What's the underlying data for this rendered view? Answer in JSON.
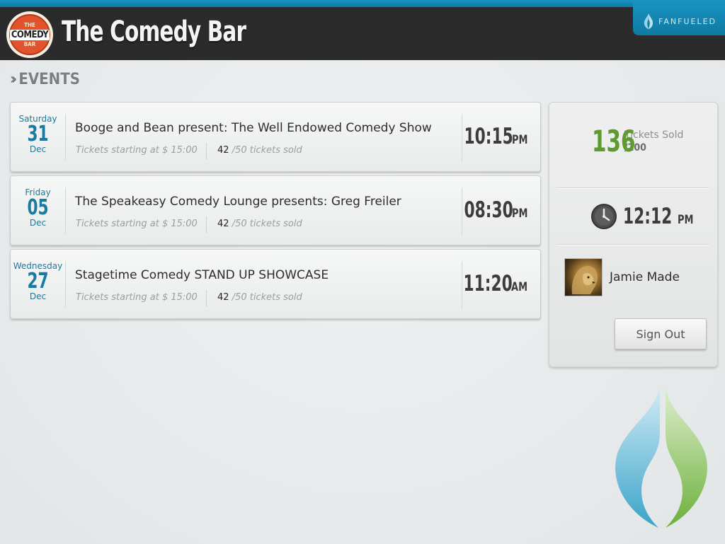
{
  "header": {
    "logo": {
      "top": "THE",
      "middle": "COMEDY",
      "bottom": "BAR"
    },
    "title": "The Comedy Bar",
    "brand": "FANFUELED"
  },
  "section": {
    "title": "EVENTS"
  },
  "events": [
    {
      "dow": "Saturday",
      "day": "31",
      "month": "Dec",
      "name": "Booge and Bean present: The Well Endowed Comedy Show",
      "price": "Tickets starting at $ 15:00",
      "sold": "42",
      "capacity": "/50 tickets sold",
      "time": "10:15",
      "ampm": "PM"
    },
    {
      "dow": "Friday",
      "day": "05",
      "month": "Dec",
      "name": "The Speakeasy Comedy Lounge presents: Greg Freiler",
      "price": "Tickets starting at $ 15:00",
      "sold": "42",
      "capacity": "/50 tickets sold",
      "time": "08:30",
      "ampm": "PM"
    },
    {
      "dow": "Wednesday",
      "day": "27",
      "month": "Dec",
      "name": "Stagetime Comedy STAND UP SHOWCASE",
      "price": "Tickets starting at $ 15:00",
      "sold": "42",
      "capacity": "/50 tickets sold",
      "time": "11:20",
      "ampm": "AM"
    }
  ],
  "panel": {
    "tickets_sold": "136",
    "tickets_label": "Tickets Sold",
    "tickets_total": "/200",
    "current_time": "12:12",
    "current_ampm": "PM",
    "clock_icon": "clock-icon",
    "user_name": "Jamie Made",
    "sign_out_label": "Sign Out"
  },
  "colors": {
    "accent": "#1488b4",
    "header_bg": "#2b2b2b",
    "date_blue": "#1a7aa0",
    "sold_green": "#5f9a2e"
  }
}
